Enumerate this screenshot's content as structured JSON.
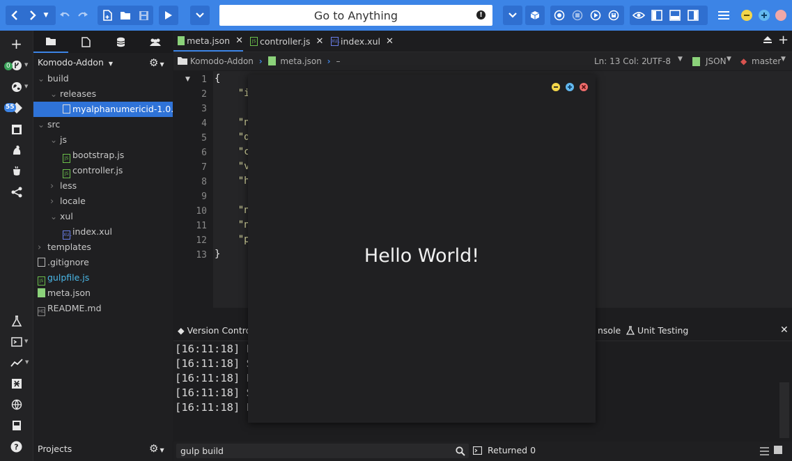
{
  "toolbar": {
    "goto_label": "Go to Anything"
  },
  "iconbar": {
    "badge_green": "0",
    "badge_blue": "55"
  },
  "sidepane": {
    "project_name": "Komodo-Addon",
    "tree": [
      {
        "label": "build",
        "indent": 0,
        "type": "folder",
        "chev": "v"
      },
      {
        "label": "releases",
        "indent": 1,
        "type": "folder",
        "chev": "v"
      },
      {
        "label": "myalphanumericid-1.0.xpi",
        "indent": 2,
        "type": "file-xpi",
        "selected": true
      },
      {
        "label": "src",
        "indent": 0,
        "type": "folder",
        "chev": "v"
      },
      {
        "label": "js",
        "indent": 1,
        "type": "folder",
        "chev": "v"
      },
      {
        "label": "bootstrap.js",
        "indent": 2,
        "type": "file-js"
      },
      {
        "label": "controller.js",
        "indent": 2,
        "type": "file-js"
      },
      {
        "label": "less",
        "indent": 1,
        "type": "folder",
        "chev": ">"
      },
      {
        "label": "locale",
        "indent": 1,
        "type": "folder",
        "chev": ">"
      },
      {
        "label": "xul",
        "indent": 1,
        "type": "folder",
        "chev": "v"
      },
      {
        "label": "index.xul",
        "indent": 2,
        "type": "file-xul"
      },
      {
        "label": "templates",
        "indent": 0,
        "type": "folder",
        "chev": ">"
      },
      {
        "label": ".gitignore",
        "indent": 0,
        "type": "file-plain"
      },
      {
        "label": "gulpfile.js",
        "indent": 0,
        "type": "file-js",
        "highlight": true
      },
      {
        "label": "meta.json",
        "indent": 0,
        "type": "file-json"
      },
      {
        "label": "README.md",
        "indent": 0,
        "type": "file-md"
      }
    ],
    "projects_label": "Projects"
  },
  "editor": {
    "tabs": [
      {
        "label": "meta.json"
      },
      {
        "label": "controller.js"
      },
      {
        "label": "index.xul"
      }
    ],
    "breadcrumb": {
      "project": "Komodo-Addon",
      "file": "meta.json",
      "symbol": "–"
    },
    "status": {
      "position": "Ln: 13 Col: 2",
      "encoding": "UTF-8",
      "language": "JSON",
      "branch": "master"
    },
    "line_numbers": [
      "1",
      "2",
      "3",
      "4",
      "5",
      "6",
      "7",
      "8",
      "9",
      "10",
      "11",
      "12",
      "13"
    ],
    "code_lines": [
      "{",
      "    \"i",
      "",
      "    \"n",
      "    \"d",
      "    \"c",
      "    \"v",
      "    \"h",
      "",
      "    \"n",
      "    \"n",
      "    \"p",
      "}"
    ]
  },
  "bottompane": {
    "tab_version_control": "Version Control",
    "tab_console_partial": "nsole",
    "tab_unit_testing": "Unit Testing",
    "log_lines": [
      "[16:11:18] F",
      "[16:11:18] S",
      "[16:11:18] F",
      "[16:11:18] S",
      "[16:11:18] F"
    ]
  },
  "statusbar": {
    "command": "gulp build",
    "result": "Returned 0"
  },
  "dialog": {
    "message": "Hello World!"
  },
  "colors": {
    "accent": "#3c84e6",
    "selection": "#2f73d8"
  }
}
